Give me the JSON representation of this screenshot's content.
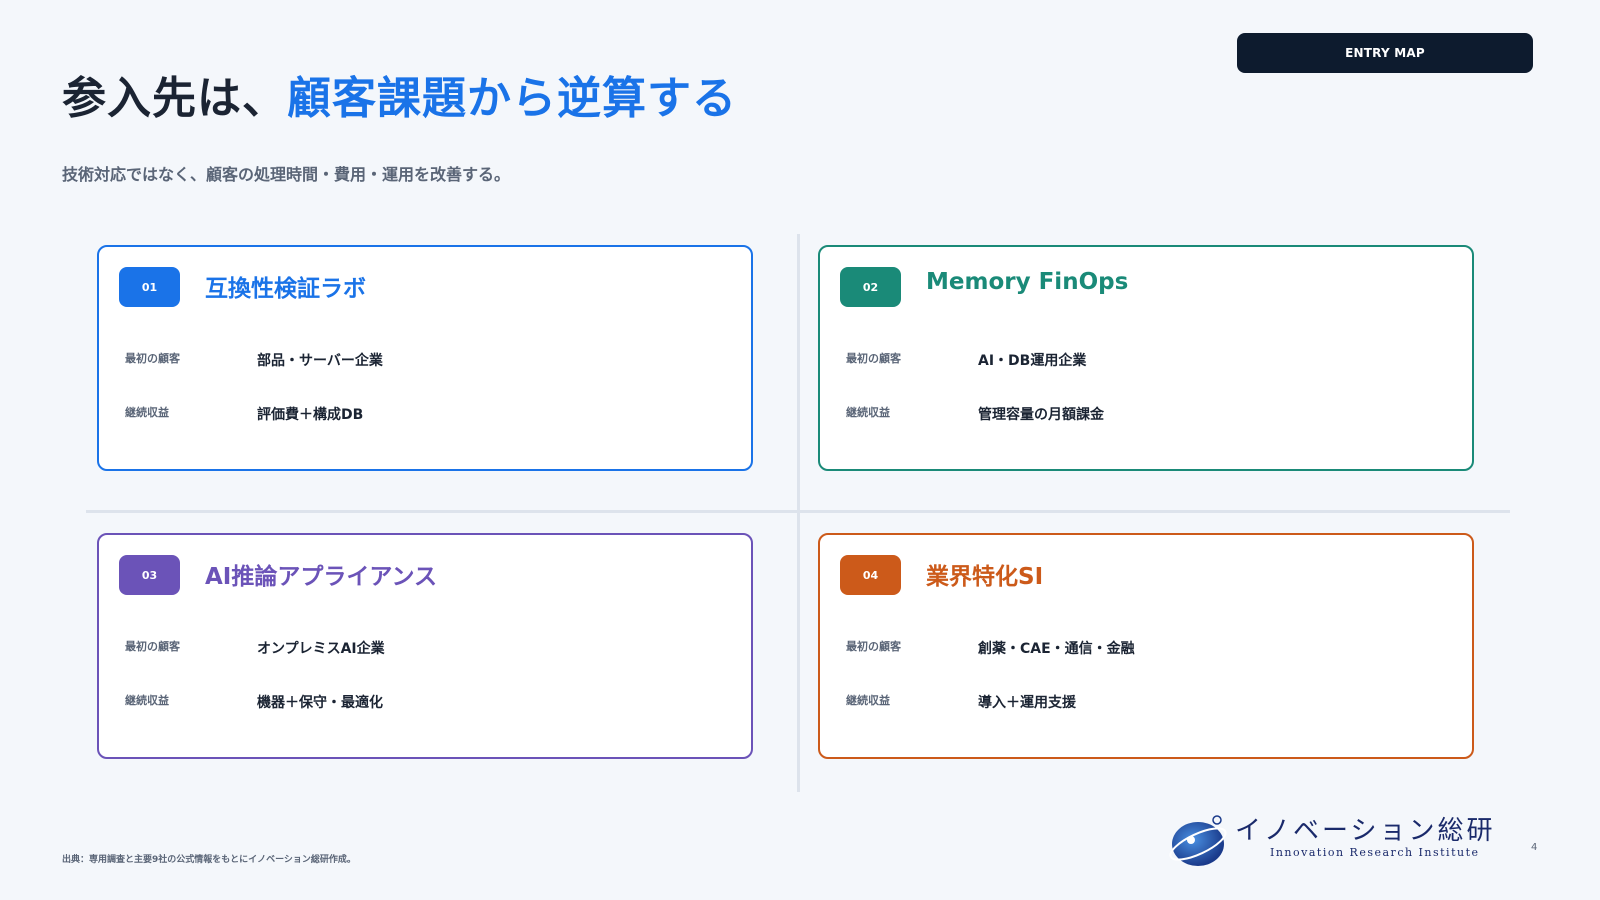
{
  "header": {
    "badge": "ENTRY MAP",
    "title_plain": "参入先は、",
    "title_accent": "顧客課題から逆算する",
    "subtitle": "技術対応ではなく、顧客の処理時間・費用・運用を改善する。"
  },
  "cards": [
    {
      "num": "01",
      "title": "互換性検証ラボ",
      "label1": "最初の顧客",
      "value1": "部品・サーバー企業",
      "label2": "継続収益",
      "value2": "評価費＋構成DB"
    },
    {
      "num": "02",
      "title": "Memory FinOps",
      "label1": "最初の顧客",
      "value1": "AI・DB運用企業",
      "label2": "継続収益",
      "value2": "管理容量の月額課金"
    },
    {
      "num": "03",
      "title": "AI推論アプライアンス",
      "label1": "最初の顧客",
      "value1": "オンプレミスAI企業",
      "label2": "継続収益",
      "value2": "機器＋保守・最適化"
    },
    {
      "num": "04",
      "title": "業界特化SI",
      "label1": "最初の顧客",
      "value1": "創薬・CAE・通信・金融",
      "label2": "継続収益",
      "value2": "導入＋運用支援"
    }
  ],
  "footer": {
    "source": "出典：専用調査と主要9社の公式情報をもとにイノベーション総研作成。",
    "page": "4",
    "logo_text": "イノベーション総研",
    "logo_sub": "Innovation Research Institute"
  },
  "colors": {
    "blue": "#1a73e8",
    "teal": "#1a8a78",
    "purple": "#6b53b8",
    "orange": "#cc5a1a",
    "navy": "#0d1b2e"
  }
}
